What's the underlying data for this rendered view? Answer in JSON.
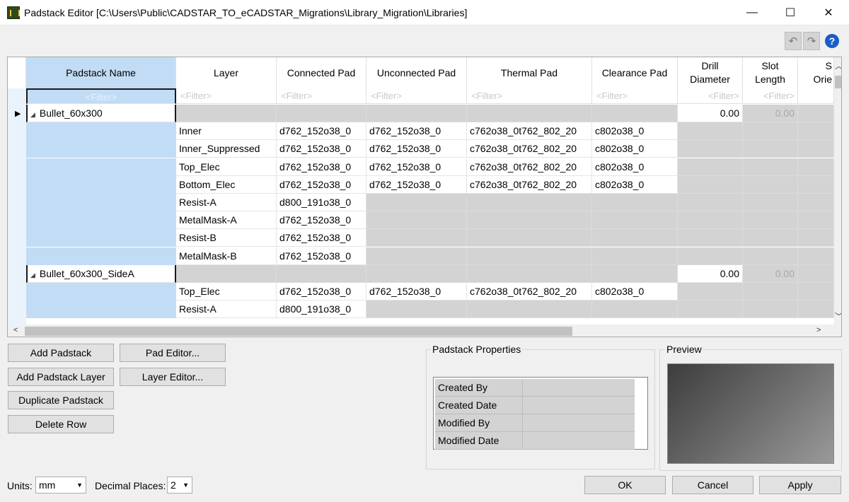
{
  "window": {
    "title": "Padstack Editor [C:\\Users\\Public\\CADSTAR_TO_eCADSTAR_Migrations\\Library_Migration\\Libraries]",
    "minimize_glyph": "—",
    "maximize_glyph": "☐",
    "close_glyph": "✕"
  },
  "toolbar": {
    "undo_glyph": "↶",
    "redo_glyph": "↷",
    "help_glyph": "?"
  },
  "grid": {
    "headers": {
      "name": "Padstack Name",
      "layer": "Layer",
      "connected": "Connected Pad",
      "unconnected": "Unconnected Pad",
      "thermal": "Thermal Pad",
      "clearance": "Clearance Pad",
      "drill_line1": "Drill",
      "drill_line2": "Diameter",
      "slot_line1": "Slot",
      "slot_line2": "Length",
      "orient_line1": "S",
      "orient_line2": "Orie"
    },
    "filter_placeholder": "<Filter>",
    "expand_glyph": "◢",
    "row_indicator_glyph": "▶",
    "padstacks": [
      {
        "name": "Bullet_60x300",
        "drill": "0.00",
        "slot": "0.00",
        "layers": [
          {
            "layer": "Inner",
            "connected": "d762_152o38_0",
            "unconnected": "d762_152o38_0",
            "thermal": "c762o38_0t762_802_20",
            "clearance": "c802o38_0"
          },
          {
            "layer": "Inner_Suppressed",
            "connected": "d762_152o38_0",
            "unconnected": "d762_152o38_0",
            "thermal": "c762o38_0t762_802_20",
            "clearance": "c802o38_0"
          },
          {
            "layer": "Top_Elec",
            "connected": "d762_152o38_0",
            "unconnected": "d762_152o38_0",
            "thermal": "c762o38_0t762_802_20",
            "clearance": "c802o38_0"
          },
          {
            "layer": "Bottom_Elec",
            "connected": "d762_152o38_0",
            "unconnected": "d762_152o38_0",
            "thermal": "c762o38_0t762_802_20",
            "clearance": "c802o38_0"
          },
          {
            "layer": "Resist-A",
            "connected": "d800_191o38_0",
            "unconnected": "",
            "thermal": "",
            "clearance": ""
          },
          {
            "layer": "MetalMask-A",
            "connected": "d762_152o38_0",
            "unconnected": "",
            "thermal": "",
            "clearance": ""
          },
          {
            "layer": "Resist-B",
            "connected": "d762_152o38_0",
            "unconnected": "",
            "thermal": "",
            "clearance": ""
          },
          {
            "layer": "MetalMask-B",
            "connected": "d762_152o38_0",
            "unconnected": "",
            "thermal": "",
            "clearance": ""
          }
        ]
      },
      {
        "name": "Bullet_60x300_SideA",
        "drill": "0.00",
        "slot": "0.00",
        "layers": [
          {
            "layer": "Top_Elec",
            "connected": "d762_152o38_0",
            "unconnected": "d762_152o38_0",
            "thermal": "c762o38_0t762_802_20",
            "clearance": "c802o38_0"
          },
          {
            "layer": "Resist-A",
            "connected": "d800_191o38_0",
            "unconnected": "",
            "thermal": "",
            "clearance": ""
          }
        ]
      }
    ],
    "scroll_left_glyph": "<",
    "scroll_right_glyph": ">",
    "scroll_up_glyph": "︿",
    "scroll_down_glyph": "﹀"
  },
  "buttons": {
    "add_padstack": "Add Padstack",
    "pad_editor": "Pad Editor...",
    "add_padstack_layer": "Add Padstack Layer",
    "layer_editor": "Layer Editor...",
    "duplicate_padstack": "Duplicate Padstack",
    "delete_row": "Delete Row",
    "ok": "OK",
    "cancel": "Cancel",
    "apply": "Apply"
  },
  "properties": {
    "title": "Padstack Properties",
    "rows": [
      {
        "key": "Created By",
        "value": ""
      },
      {
        "key": "Created Date",
        "value": ""
      },
      {
        "key": "Modified By",
        "value": ""
      },
      {
        "key": "Modified Date",
        "value": ""
      }
    ]
  },
  "preview": {
    "title": "Preview"
  },
  "footer": {
    "units_label": "Units:",
    "units_value": "mm",
    "decimal_label": "Decimal Places:",
    "decimal_value": "2",
    "dropdown_glyph": "▼"
  }
}
